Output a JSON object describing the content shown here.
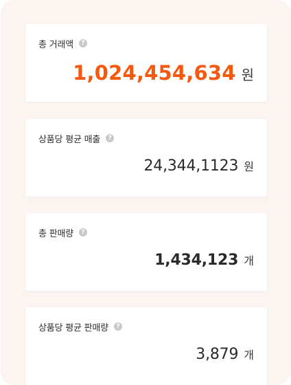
{
  "cards": [
    {
      "title": "총 거래액",
      "value": "1,024,454,634",
      "unit": "원"
    },
    {
      "title": "상품당 평균 매출",
      "value": "24,344,1123",
      "unit": "원"
    },
    {
      "title": "총 판매량",
      "value": "1,434,123",
      "unit": "개"
    },
    {
      "title": "상품당 평균 판매량",
      "value": "3,879",
      "unit": "개"
    }
  ],
  "help_glyph": "?",
  "colors": {
    "accent": "#f5590f",
    "panel_bg": "#fcf4f1",
    "card_bg": "#ffffff"
  }
}
